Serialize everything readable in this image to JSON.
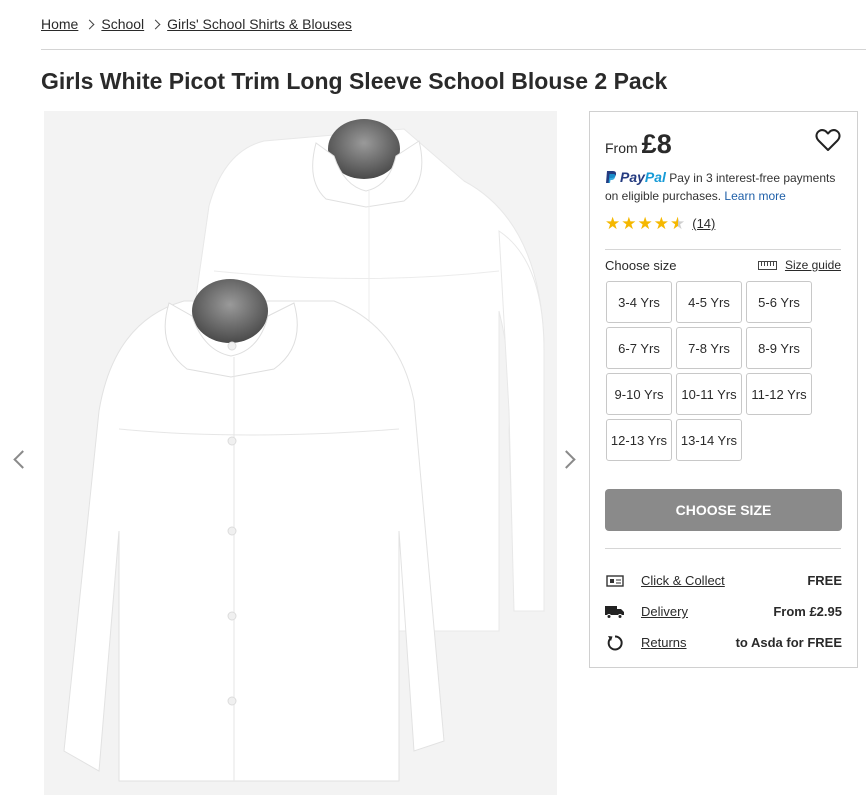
{
  "breadcrumb": [
    "Home",
    "School",
    "Girls' School Shirts & Blouses"
  ],
  "product": {
    "title": "Girls White Picot Trim Long Sleeve School Blouse 2 Pack"
  },
  "icons": {
    "breadcrumb_separator": "chevron-right-icon",
    "wishlist": "heart-icon",
    "gallery_prev": "chevron-left-icon",
    "gallery_next": "chevron-right-icon",
    "size_guide": "ruler-icon",
    "click_collect": "store-icon",
    "delivery": "truck-icon",
    "returns": "return-arrow-icon"
  },
  "pricing": {
    "from_label": "From",
    "price": "£8"
  },
  "paypal": {
    "brand_pay": "Pay",
    "brand_pal": "Pal",
    "text": "Pay in 3 interest-free payments on eligible purchases.",
    "learn_more": "Learn more"
  },
  "rating": {
    "stars": 4.5,
    "count_label": "(14)"
  },
  "size": {
    "label": "Choose size",
    "guide_label": "Size guide",
    "options": [
      "3-4 Yrs",
      "4-5 Yrs",
      "5-6 Yrs",
      "6-7 Yrs",
      "7-8 Yrs",
      "8-9 Yrs",
      "9-10 Yrs",
      "10-11 Yrs",
      "11-12 Yrs",
      "12-13 Yrs",
      "13-14 Yrs"
    ]
  },
  "cta": {
    "label": "CHOOSE SIZE"
  },
  "delivery": [
    {
      "label": "Click & Collect",
      "value": "FREE"
    },
    {
      "label": "Delivery",
      "value": "From £2.95"
    },
    {
      "label": "Returns",
      "value": "to Asda for FREE"
    }
  ],
  "colors": {
    "cta_bg": "#8a8a8a",
    "star": "#f5b800",
    "paypal_dark": "#253b80",
    "paypal_light": "#179bd7",
    "link_blue": "#1f5fa8",
    "gallery_bg": "#f3f3f3"
  }
}
